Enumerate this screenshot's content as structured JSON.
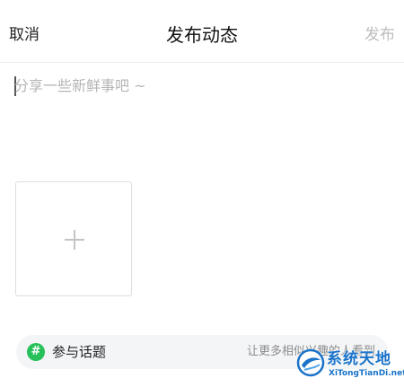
{
  "header": {
    "cancel_label": "取消",
    "title": "发布动态",
    "publish_label": "发布"
  },
  "compose": {
    "placeholder": "分享一些新鲜事吧 ~",
    "value": ""
  },
  "media": {
    "add_icon": "plus-icon"
  },
  "topic": {
    "icon": "hash-icon",
    "icon_glyph": "#",
    "label": "参与话题",
    "hint": "让更多相似兴趣的人看到"
  },
  "watermark": {
    "title": "系统天地",
    "subtitle": "XiTongTianDi.net"
  },
  "colors": {
    "topic_icon": "#27c05a",
    "publish_disabled": "#bdbdbd",
    "watermark": "#1a73c9"
  }
}
